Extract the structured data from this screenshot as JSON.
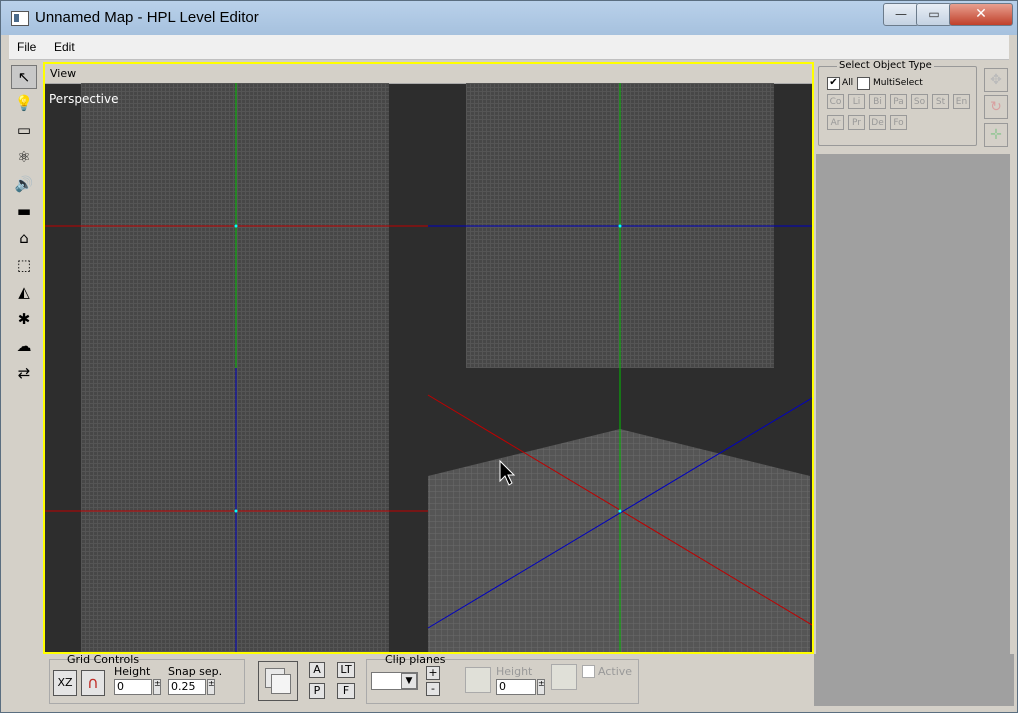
{
  "window": {
    "title": "Unnamed Map - HPL Level Editor",
    "min_glyph": "—",
    "max_glyph": "▭",
    "close_glyph": "✕"
  },
  "menu": {
    "file": "File",
    "edit": "Edit"
  },
  "toolbar": {
    "tools": [
      {
        "icon": "select-arrow-icon",
        "glyph": "↖"
      },
      {
        "icon": "light-bulb-icon",
        "glyph": "💡"
      },
      {
        "icon": "billboard-icon",
        "glyph": "▭"
      },
      {
        "icon": "particle-atom-icon",
        "glyph": "⚛"
      },
      {
        "icon": "sound-icon",
        "glyph": "🔊"
      },
      {
        "icon": "static-object-icon",
        "glyph": "▬"
      },
      {
        "icon": "area-ghost-icon",
        "glyph": "⌂"
      },
      {
        "icon": "primitive-box-icon",
        "glyph": "⬚"
      },
      {
        "icon": "decal-icon",
        "glyph": "◭"
      },
      {
        "icon": "fog-star-icon",
        "glyph": "✱"
      },
      {
        "icon": "entity-icon",
        "glyph": "☁"
      },
      {
        "icon": "combine-icon",
        "glyph": "⇄"
      }
    ]
  },
  "viewport": {
    "header": "View",
    "camera_label": "Perspective"
  },
  "select_panel": {
    "title": "Select Object Type",
    "all_label": "All",
    "multiselect_label": "MultiSelect",
    "row1": [
      "Co",
      "Li",
      "Bi",
      "Pa",
      "So",
      "St",
      "En"
    ],
    "row2": [
      "Ar",
      "Pr",
      "De",
      "Fo"
    ]
  },
  "grid_controls": {
    "title": "Grid Controls",
    "plane_button": "XZ",
    "height_label": "Height",
    "height_value": "0",
    "snap_label": "Snap sep.",
    "snap_value": "0.25"
  },
  "view_buttons": {
    "a": "A",
    "p": "P",
    "lt": "LT",
    "f": "F"
  },
  "clip_planes": {
    "title": "Clip planes",
    "plus": "+",
    "minus": "-",
    "height_label": "Height",
    "height_value": "0",
    "active_label": "Active"
  },
  "colors": {
    "viewport_border": "#ffff00",
    "axis_x": "#c00000",
    "axis_y": "#00c000",
    "axis_z": "#0000c0"
  }
}
